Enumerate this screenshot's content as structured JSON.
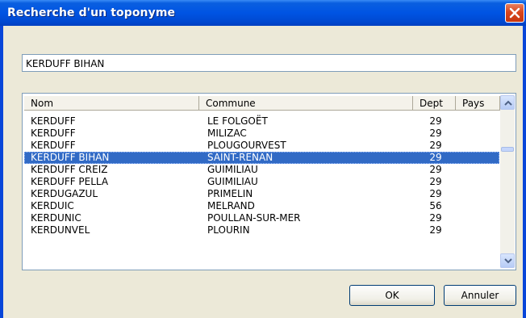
{
  "window": {
    "title": "Recherche d'un toponyme",
    "close_icon": "close-icon"
  },
  "search": {
    "value": "KERDUFF BIHAN"
  },
  "table": {
    "columns": [
      "Nom",
      "Commune",
      "Dept",
      "Pays"
    ],
    "rows": [
      {
        "nom": "KERDUFF",
        "commune": "LE FOLGOËT",
        "dept": "29",
        "pays": ""
      },
      {
        "nom": "KERDUFF",
        "commune": "MILIZAC",
        "dept": "29",
        "pays": ""
      },
      {
        "nom": "KERDUFF",
        "commune": "PLOUGOURVEST",
        "dept": "29",
        "pays": ""
      },
      {
        "nom": "KERDUFF BIHAN",
        "commune": "SAINT-RENAN",
        "dept": "29",
        "pays": ""
      },
      {
        "nom": "KERDUFF CREIZ",
        "commune": "GUIMILIAU",
        "dept": "29",
        "pays": ""
      },
      {
        "nom": "KERDUFF PELLA",
        "commune": "GUIMILIAU",
        "dept": "29",
        "pays": ""
      },
      {
        "nom": "KERDUGAZUL",
        "commune": "PRIMELIN",
        "dept": "29",
        "pays": ""
      },
      {
        "nom": "KERDUIC",
        "commune": "MELRAND",
        "dept": "56",
        "pays": ""
      },
      {
        "nom": "KERDUNIC",
        "commune": "POULLAN-SUR-MER",
        "dept": "29",
        "pays": ""
      },
      {
        "nom": "KERDUNVEL",
        "commune": "PLOURIN",
        "dept": "29",
        "pays": ""
      }
    ],
    "selected_index": 3
  },
  "buttons": {
    "ok": "OK",
    "cancel": "Annuler"
  },
  "colors": {
    "titlebar": "#0054e3",
    "selection": "#316ac5",
    "close": "#d9461d",
    "dialog_bg": "#ece9d8"
  }
}
